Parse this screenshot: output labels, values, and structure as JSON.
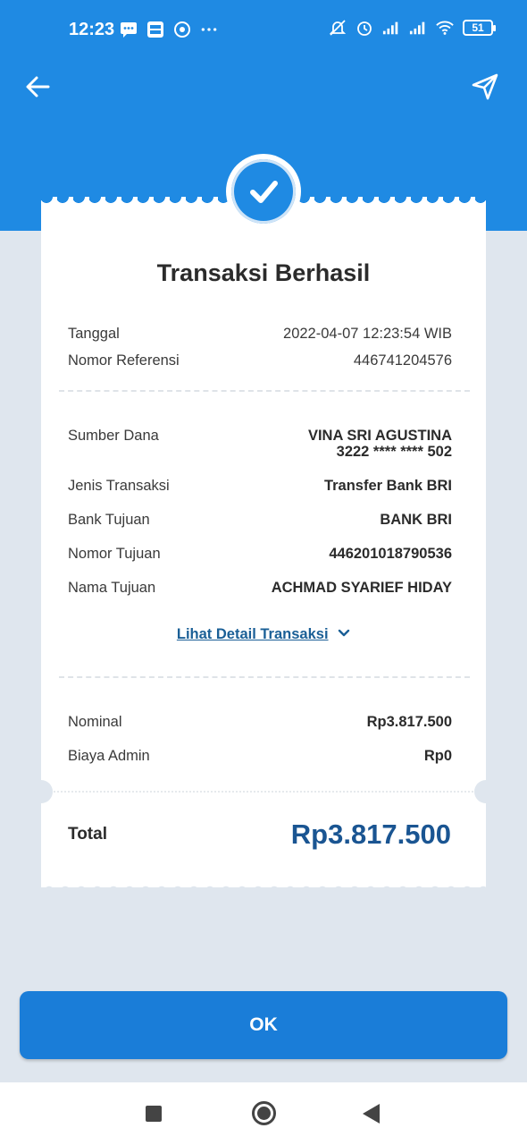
{
  "status_bar": {
    "time": "12:23",
    "battery": "51",
    "left_icons": [
      "message-icon",
      "bri-mo-icon",
      "chrome-icon",
      "more-dots-icon"
    ],
    "right_icons": [
      "mute-icon",
      "alarm-icon",
      "signal-icon",
      "signal-icon",
      "wifi-icon",
      "battery-icon"
    ]
  },
  "header": {
    "back_icon": "arrow-left-icon",
    "share_icon": "send-icon"
  },
  "receipt": {
    "title": "Transaksi Berhasil",
    "section1": [
      {
        "label": "Tanggal",
        "value": "2022-04-07 12:23:54 WIB"
      },
      {
        "label": "Nomor Referensi",
        "value": "446741204576"
      }
    ],
    "sumber_dana": {
      "label": "Sumber Dana",
      "name": "VINA SRI AGUSTINA",
      "account": "3222 **** **** 502"
    },
    "section2": [
      {
        "label": "Jenis Transaksi",
        "value": "Transfer Bank BRI"
      },
      {
        "label": "Bank Tujuan",
        "value": "BANK BRI"
      },
      {
        "label": "Nomor Tujuan",
        "value": "446201018790536"
      },
      {
        "label": "Nama Tujuan",
        "value": "ACHMAD SYARIEF HIDAY"
      }
    ],
    "detail_link": "Lihat Detail Transaksi",
    "section3": [
      {
        "label": "Nominal",
        "value": "Rp3.817.500"
      },
      {
        "label": "Biaya Admin",
        "value": "Rp0"
      }
    ],
    "total_label": "Total",
    "total_value": "Rp3.817.500"
  },
  "ok_button": "OK",
  "colors": {
    "primary": "#1f8ae3",
    "button": "#1a7dd8",
    "total_text": "#1a5592",
    "background": "#dfe6ee"
  }
}
